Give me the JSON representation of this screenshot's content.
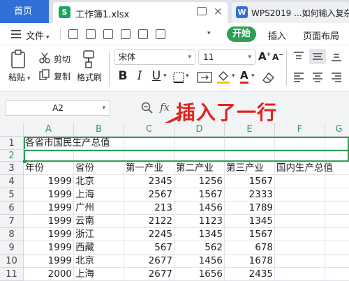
{
  "titlebar": {
    "home_tab": "首页",
    "file_tab": "工作簿1.xlsx",
    "file_tab_badge": "S",
    "doc_tab": "WPS2019 ...如何输入复杂",
    "doc_tab_badge": "W"
  },
  "menubar": {
    "file": "文件",
    "start": "开始",
    "insert": "插入",
    "page_layout": "页面布局"
  },
  "ribbon": {
    "paste": "粘贴",
    "cut": "剪切",
    "copy": "复制",
    "format_painter": "格式刷",
    "font_name": "宋体",
    "font_size": "11",
    "bold": "B",
    "italic": "I",
    "underline": "U",
    "font_color_glyph": "A"
  },
  "formula_bar": {
    "name_box": "A2",
    "fx": "fx"
  },
  "annotation": "插入了一行",
  "colors": {
    "accent_green": "#2f9e57",
    "home_blue": "#2f6fd6",
    "annotation_red": "#e2231a"
  },
  "sheet": {
    "columns": [
      "A",
      "B",
      "C",
      "D",
      "E",
      "F",
      "G"
    ],
    "rows": [
      {
        "n": "1",
        "cells": [
          "各省市国民生产总值",
          "",
          "",
          "",
          "",
          ""
        ]
      },
      {
        "n": "2",
        "cells": [
          "",
          "",
          "",
          "",
          "",
          ""
        ]
      },
      {
        "n": "3",
        "cells": [
          "年份",
          "省份",
          "第一产业",
          "第二产业",
          "第三产业",
          "国内生产总值"
        ]
      },
      {
        "n": "4",
        "cells": [
          "1999",
          "北京",
          "2345",
          "1256",
          "1567",
          ""
        ]
      },
      {
        "n": "5",
        "cells": [
          "1999",
          "上海",
          "2567",
          "1567",
          "2333",
          ""
        ]
      },
      {
        "n": "6",
        "cells": [
          "1999",
          "广州",
          "213",
          "1456",
          "1789",
          ""
        ]
      },
      {
        "n": "7",
        "cells": [
          "1999",
          "云南",
          "2122",
          "1123",
          "1345",
          ""
        ]
      },
      {
        "n": "8",
        "cells": [
          "1999",
          "浙江",
          "2245",
          "1345",
          "1567",
          ""
        ]
      },
      {
        "n": "9",
        "cells": [
          "1999",
          "西藏",
          "567",
          "562",
          "678",
          ""
        ]
      },
      {
        "n": "10",
        "cells": [
          "1999",
          "北京",
          "2677",
          "1456",
          "1678",
          ""
        ]
      },
      {
        "n": "11",
        "cells": [
          "2000",
          "上海",
          "2677",
          "1656",
          "2435",
          ""
        ]
      }
    ]
  }
}
